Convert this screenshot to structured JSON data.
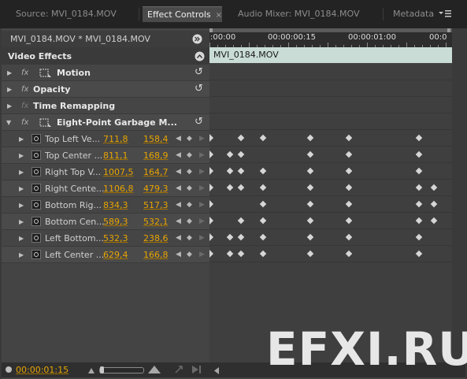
{
  "tabs": [
    {
      "label": "Source: MVI_0184.MOV",
      "active": false
    },
    {
      "label": "Effect Controls",
      "active": true,
      "close": "×"
    },
    {
      "label": "Audio Mixer: MVI_0184.MOV",
      "active": false
    },
    {
      "label": "Metadata",
      "active": false
    }
  ],
  "panel_menu_icon": "panel-menu-icon",
  "header": {
    "clip_path": "MVI_0184.MOV * MVI_0184.MOV",
    "section_title": "Video Effects"
  },
  "timeline": {
    "timecodes": [
      ":00:00",
      "00:00:00:15",
      "00:00:01:00",
      "00:0"
    ],
    "clip_label": "MVI_0184.MOV"
  },
  "effects": [
    {
      "name": "Motion",
      "fx": "fx",
      "reset": "↺"
    },
    {
      "name": "Opacity",
      "fx": "fx",
      "reset": "↺"
    },
    {
      "name": "Time Remapping",
      "fx": "fx"
    },
    {
      "name": "Eight-Point Garbage M...",
      "fx": "fx",
      "reset": "↺"
    }
  ],
  "params": [
    {
      "name": "Top Left Ve...",
      "x": "711,8",
      "y": "158,4"
    },
    {
      "name": "Top Center ...",
      "x": "811,1",
      "y": "168,9"
    },
    {
      "name": "Right Top V...",
      "x": "1007,5",
      "y": "164,7"
    },
    {
      "name": "Right Cente...",
      "x": "1106,8",
      "y": "479,3"
    },
    {
      "name": "Bottom Rig...",
      "x": "834,3",
      "y": "517,3"
    },
    {
      "name": "Bottom Cen...",
      "x": "589,3",
      "y": "532,1"
    },
    {
      "name": "Left Bottom...",
      "x": "532,3",
      "y": "238,6"
    },
    {
      "name": "Left Center ...",
      "x": "629,4",
      "y": "166,8"
    }
  ],
  "current_time": "00:00:01:15",
  "watermark": "EFXI.RU",
  "colors": {
    "value": "#e8a400",
    "clip_bar": "#c9dcd6",
    "active_tab": "#4a4a4a"
  }
}
